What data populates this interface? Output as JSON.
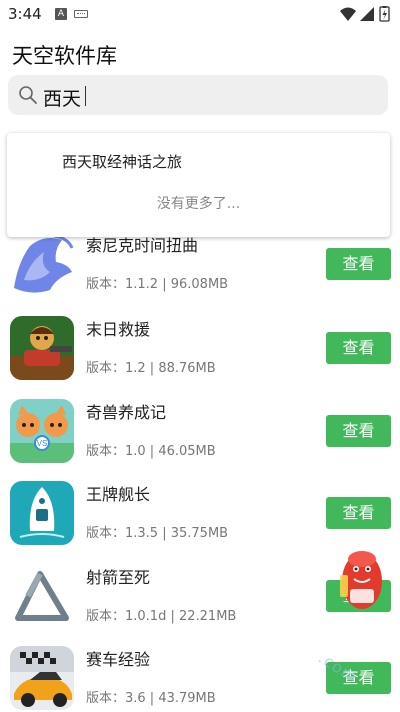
{
  "status": {
    "time": "3:44",
    "notif_a": "A"
  },
  "app": {
    "title": "天空软件库"
  },
  "search": {
    "value": "西天"
  },
  "dropdown": {
    "suggestion": "西天取经神话之旅",
    "no_more": "没有更多了..."
  },
  "apps": [
    {
      "name": "索尼克时间扭曲",
      "meta": "版本：1.1.2 | 96.08MB",
      "button": "查看"
    },
    {
      "name": "末日救援",
      "meta": "版本：1.2 | 88.76MB",
      "button": "查看"
    },
    {
      "name": "奇兽养成记",
      "meta": "版本：1.0 | 46.05MB",
      "button": "查看"
    },
    {
      "name": "王牌舰长",
      "meta": "版本：1.3.5 | 35.75MB",
      "button": "查看"
    },
    {
      "name": "射箭至死",
      "meta": "版本：1.0.1d | 22.21MB",
      "button": "查看"
    },
    {
      "name": "赛车经验",
      "meta": "版本：3.6 | 43.79MB",
      "button": "查看"
    }
  ],
  "watermark": {
    "text": ".com"
  },
  "colors": {
    "accent_green": "#41b85a",
    "search_bg": "#efefef"
  }
}
